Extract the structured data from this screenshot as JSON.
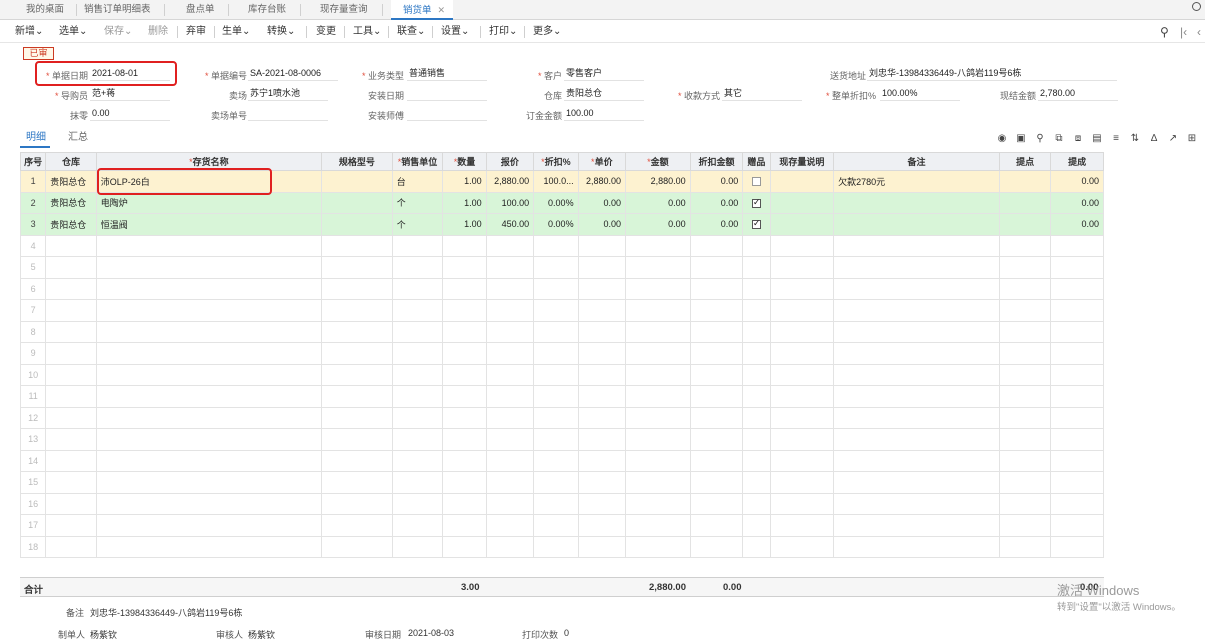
{
  "tabs": [
    {
      "label": "我的桌面"
    },
    {
      "label": "销售订单明细表"
    },
    {
      "label": "盘点单"
    },
    {
      "label": "库存台账"
    },
    {
      "label": "现存量查询"
    },
    {
      "label": "销货单",
      "close": "✕"
    }
  ],
  "toolbar": {
    "items": [
      "新增",
      "选单",
      "保存",
      "删除",
      "弃审",
      "生单",
      "转换",
      "变更",
      "工具",
      "联查",
      "设置",
      "打印",
      "更多"
    ],
    "dropdown_arrow": "⌄"
  },
  "status_stamp": "已审",
  "form": {
    "doc_date": {
      "label": "单据日期",
      "value": "2021-08-01"
    },
    "doc_no": {
      "label": "单据编号",
      "value": "SA-2021-08-0006"
    },
    "biz_type": {
      "label": "业务类型",
      "value": "普通销售"
    },
    "customer": {
      "label": "客户",
      "value": "零售客户"
    },
    "ship_addr": {
      "label": "送货地址",
      "value": "刘忠华-13984336449-八鸽岩119号6栋"
    },
    "buyer_guide": {
      "label": "导购员",
      "value": "范+蒋"
    },
    "store": {
      "label": "卖场",
      "value": "苏宁1喷水池"
    },
    "install_date": {
      "label": "安装日期",
      "value": ""
    },
    "warehouse": {
      "label": "仓库",
      "value": "贵阳总仓"
    },
    "pay_method": {
      "label": "收款方式",
      "value": "其它"
    },
    "discount_rate": {
      "label": "整单折扣%",
      "value": "100.00%"
    },
    "cash_amount": {
      "label": "现结金额",
      "value": "2,780.00"
    },
    "round_off": {
      "label": "抹零",
      "value": "0.00"
    },
    "store_doc_no": {
      "label": "卖场单号",
      "value": ""
    },
    "installer": {
      "label": "安装师傅",
      "value": ""
    },
    "deposit": {
      "label": "订金金额",
      "value": "100.00"
    }
  },
  "subtabs": [
    "明细",
    "汇总"
  ],
  "grid": {
    "headers": [
      "序号",
      "仓库",
      "存货名称",
      "规格型号",
      "销售单位",
      "数量",
      "报价",
      "折扣%",
      "单价",
      "金额",
      "折扣金额",
      "赠品",
      "现存量说明",
      "备注",
      "提点",
      "提成"
    ],
    "required": [
      false,
      false,
      true,
      false,
      true,
      true,
      false,
      true,
      true,
      true,
      false,
      false,
      false,
      false,
      false,
      false
    ],
    "rows": [
      {
        "idx": "1",
        "warehouse": "贵阳总仓",
        "name": "沛OLP-26白",
        "spec": "",
        "unit": "台",
        "qty": "1.00",
        "quote": "2,880.00",
        "disc": "100.0...",
        "price": "2,880.00",
        "amount": "2,880.00",
        "disc_amt": "0.00",
        "gift": false,
        "stock_note": "",
        "remark": "欠款2780元",
        "point": "",
        "commission": "0.00"
      },
      {
        "idx": "2",
        "warehouse": "贵阳总仓",
        "name": "电陶炉",
        "spec": "",
        "unit": "个",
        "qty": "1.00",
        "quote": "100.00",
        "disc": "0.00%",
        "price": "0.00",
        "amount": "0.00",
        "disc_amt": "0.00",
        "gift": true,
        "stock_note": "",
        "remark": "",
        "point": "",
        "commission": "0.00"
      },
      {
        "idx": "3",
        "warehouse": "贵阳总仓",
        "name": "恒温阀",
        "spec": "",
        "unit": "个",
        "qty": "1.00",
        "quote": "450.00",
        "disc": "0.00%",
        "price": "0.00",
        "amount": "0.00",
        "disc_amt": "0.00",
        "gift": true,
        "stock_note": "",
        "remark": "",
        "point": "",
        "commission": "0.00"
      }
    ],
    "empty_rows": [
      "4",
      "5",
      "6",
      "7",
      "8",
      "9",
      "10",
      "11",
      "12",
      "13",
      "14",
      "15",
      "16",
      "17",
      "18"
    ]
  },
  "totals": {
    "label": "合计",
    "qty": "3.00",
    "amount": "2,880.00",
    "disc_amt": "0.00",
    "commission": "0.00"
  },
  "footer": {
    "remark": {
      "label": "备注",
      "value": "刘忠华-13984336449-八鸽岩119号6栋"
    },
    "maker": {
      "label": "制单人",
      "value": "杨紫钦"
    },
    "auditor": {
      "label": "审核人",
      "value": "杨紫钦"
    },
    "audit_date": {
      "label": "审核日期",
      "value": "2021-08-03"
    },
    "print_count": {
      "label": "打印次数",
      "value": "0"
    }
  },
  "watermark": {
    "line1": "激活 Windows",
    "line2": "转到\"设置\"以激活 Windows。"
  },
  "colors": {
    "accent": "#2d77c4",
    "highlight": "#e02020",
    "selected_row": "#fdf2d0",
    "gift_row": "#d8f5d8",
    "required_star": "#e04e3d"
  }
}
